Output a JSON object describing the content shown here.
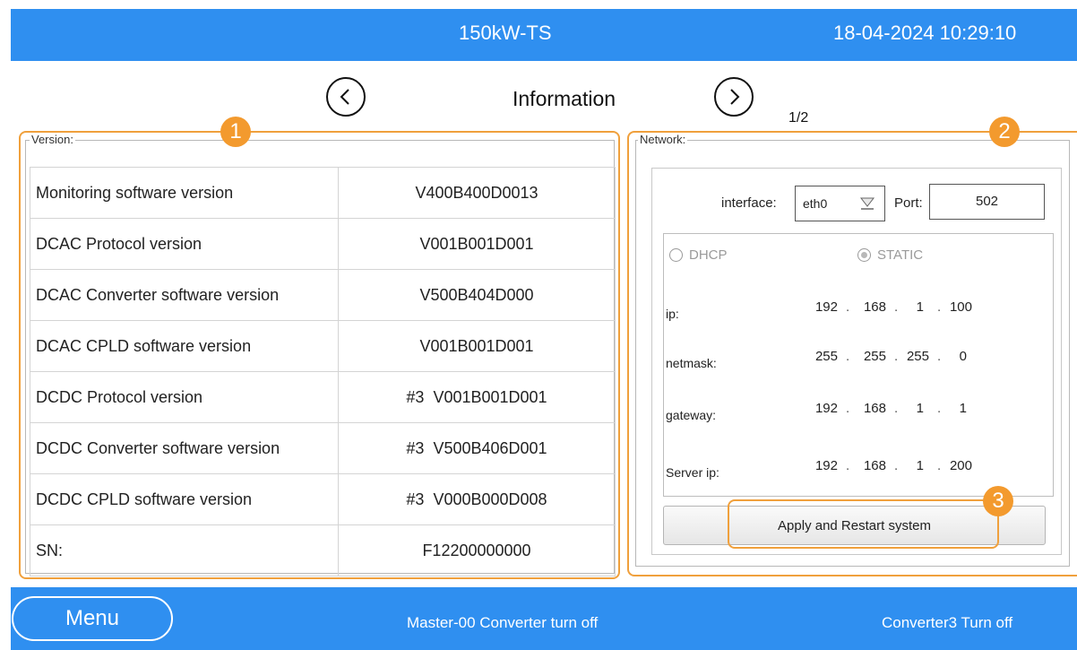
{
  "header": {
    "device_name": "150kW-TS",
    "datetime": "18-04-2024 10:29:10"
  },
  "page": {
    "title": "Information",
    "indicator": "1/2",
    "prev_icon": "chevron-left-icon",
    "next_icon": "chevron-right-icon"
  },
  "markers": [
    "1",
    "2",
    "3"
  ],
  "version": {
    "legend": "Version:",
    "rows": [
      {
        "label": "Monitoring software version",
        "value": "V400B400D0013"
      },
      {
        "label": "DCAC Protocol version",
        "value": "V001B001D001"
      },
      {
        "label": "DCAC Converter software version",
        "value": "V500B404D000"
      },
      {
        "label": "DCAC CPLD software version",
        "value": "V001B001D001"
      },
      {
        "label": "DCDC Protocol version",
        "value": "#3  V001B001D001"
      },
      {
        "label": "DCDC Converter software version",
        "value": "#3  V500B406D001"
      },
      {
        "label": "DCDC CPLD software version",
        "value": "#3  V000B000D008"
      },
      {
        "label": "SN:",
        "value": "F12200000000"
      }
    ]
  },
  "network": {
    "legend": "Network:",
    "interface_label": "interface:",
    "interface_value": "eth0",
    "port_label": "Port:",
    "port_value": "502",
    "mode_dhcp": "DHCP",
    "mode_static": "STATIC",
    "selected_mode": "STATIC",
    "ip": {
      "label": "ip:",
      "octets": [
        "192",
        "168",
        "1",
        "100"
      ]
    },
    "netmask": {
      "label": "netmask:",
      "octets": [
        "255",
        "255",
        "255",
        "0"
      ]
    },
    "gateway": {
      "label": "gateway:",
      "octets": [
        "192",
        "168",
        "1",
        "1"
      ]
    },
    "server_ip": {
      "label": "Server ip:",
      "octets": [
        "192",
        "168",
        "1",
        "200"
      ]
    },
    "apply_label": "Apply and Restart system"
  },
  "footer": {
    "menu_label": "Menu",
    "status_left": "Master-00 Converter turn off",
    "status_right": "Converter3 Turn off"
  },
  "colors": {
    "bar_blue": "#2f8ff0",
    "highlight_orange": "#f39a2e"
  }
}
